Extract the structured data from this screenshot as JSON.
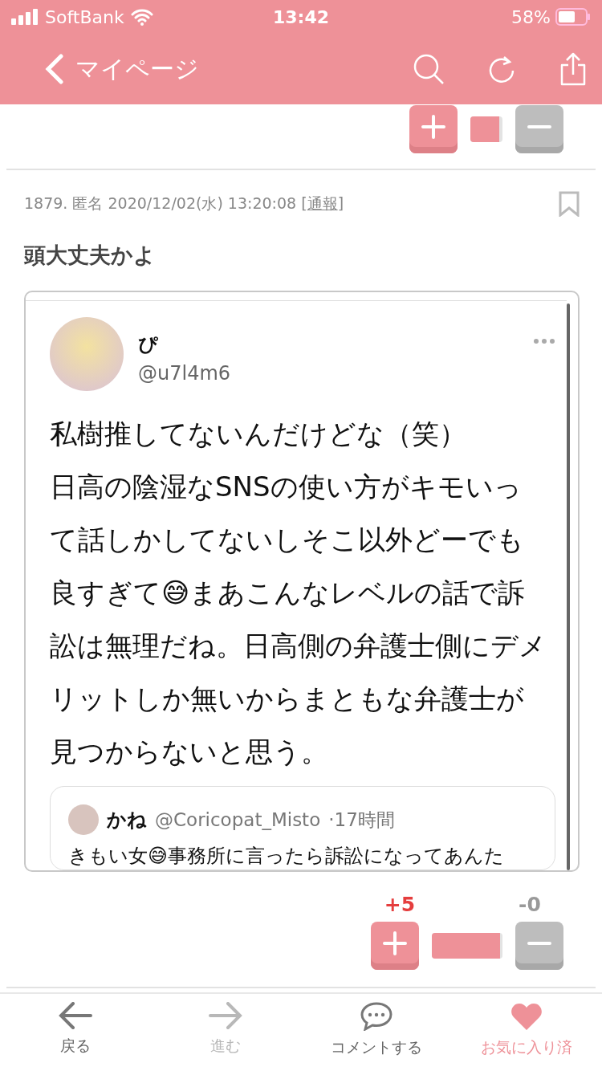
{
  "status_bar": {
    "carrier": "SoftBank",
    "time": "13:42",
    "battery": "58%"
  },
  "nav": {
    "back_label": "マイページ"
  },
  "post": {
    "meta": "1879. 匿名 2020/12/02(水) 13:20:08 [",
    "report": "通報",
    "meta_end": "]",
    "bookmarked": false,
    "title": "頭大丈夫かよ",
    "embed": {
      "name": "ぴ",
      "handle": "@u7l4m6",
      "lines": [
        "私樹推してないんだけどな（笑）",
        "日高の陰湿なSNSの使い方がキモいって話しかしてないしそこ以外どーでも良すぎて😅まあこんなレベルの話で訴訟は無理だね。日高側の弁護士側にデメリットしか無いからまともな弁護士が見つからないと思う。"
      ],
      "quote": {
        "name": "かね",
        "handle": "@Coricopat_Misto",
        "time": "·17時間",
        "text": "きもい女😅事務所に言ったら訴訟になってあんた"
      }
    },
    "votes": {
      "plus": "+5",
      "minus": "-0",
      "level": 1
    }
  },
  "tabbar": [
    {
      "label": "戻る",
      "kind": "back",
      "disabled": false,
      "selected": false
    },
    {
      "label": "進む",
      "kind": "forward",
      "disabled": true,
      "selected": false
    },
    {
      "label": "コメントする",
      "kind": "comment",
      "disabled": false,
      "selected": false
    },
    {
      "label": "お気に入り済",
      "kind": "favorite",
      "disabled": false,
      "selected": true
    }
  ]
}
